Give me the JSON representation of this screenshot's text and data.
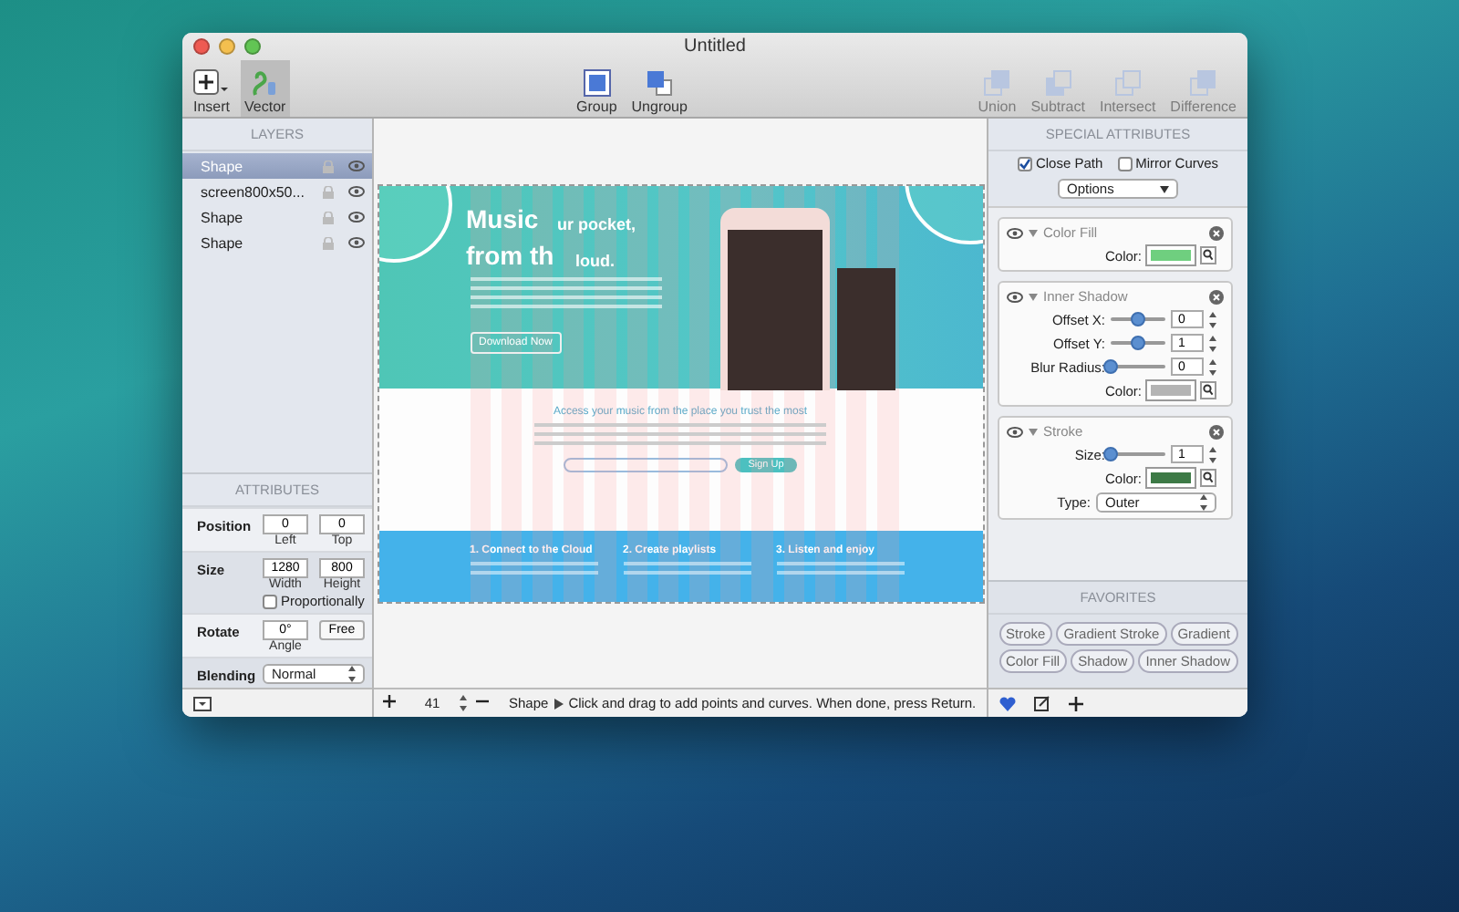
{
  "window": {
    "title": "Untitled"
  },
  "toolbar": {
    "left": [
      {
        "kind": "insert",
        "label": "Insert",
        "selected": false
      },
      {
        "kind": "vector",
        "label": "Vector",
        "selected": true
      }
    ],
    "center": [
      {
        "kind": "group",
        "label": "Group",
        "disabled": false
      },
      {
        "kind": "ungroup",
        "label": "Ungroup",
        "disabled": false
      }
    ],
    "right": [
      {
        "kind": "union",
        "label": "Union",
        "disabled": true
      },
      {
        "kind": "subtract",
        "label": "Subtract",
        "disabled": true
      },
      {
        "kind": "intersect",
        "label": "Intersect",
        "disabled": true
      },
      {
        "kind": "difference",
        "label": "Difference",
        "disabled": true
      }
    ]
  },
  "layers": {
    "title": "LAYERS",
    "items": [
      {
        "name": "Shape",
        "selected": true
      },
      {
        "name": "screen800x50...",
        "selected": false
      },
      {
        "name": "Shape",
        "selected": false
      },
      {
        "name": "Shape",
        "selected": false
      }
    ]
  },
  "attributes": {
    "title": "ATTRIBUTES",
    "rows": [
      {
        "kind": "fields",
        "label": "Position",
        "fields": [
          {
            "value": "0",
            "caption": "Left"
          },
          {
            "value": "0",
            "caption": "Top"
          }
        ]
      },
      {
        "kind": "fields",
        "label": "Size",
        "fields": [
          {
            "value": "1280",
            "caption": "Width"
          },
          {
            "value": "800",
            "caption": "Height"
          }
        ],
        "checkbox": {
          "label": "Proportionally",
          "checked": false
        }
      },
      {
        "kind": "fields",
        "label": "Rotate",
        "fields": [
          {
            "value": "0°",
            "caption": "Angle"
          }
        ],
        "button": "Free"
      },
      {
        "kind": "select",
        "label": "Blending",
        "value": "Normal"
      }
    ]
  },
  "canvas": {
    "document": {
      "hero_lines": [
        "Music",
        "ur pocket,",
        "from th",
        "loud."
      ],
      "download": "Download Now",
      "tagline": "Access your music from the place you trust the most",
      "signup": "Sign Up",
      "steps": [
        "1. Connect to the Cloud",
        "2. Create playlists",
        "3. Listen and enjoy"
      ]
    }
  },
  "status": {
    "zoom": "41",
    "tool": "Shape",
    "hint": "Click and drag to add points and curves. When done, press Return."
  },
  "special": {
    "title": "SPECIAL ATTRIBUTES",
    "close_path": {
      "label": "Close Path",
      "checked": true
    },
    "mirror_curves": {
      "label": "Mirror Curves",
      "checked": false
    },
    "options": "Options",
    "effects": [
      {
        "title": "Color Fill",
        "rows": [
          {
            "kind": "color",
            "label": "Color:",
            "color": "#6fcf7f"
          }
        ]
      },
      {
        "title": "Inner Shadow",
        "rows": [
          {
            "kind": "slider",
            "label": "Offset X:",
            "level": 0.5,
            "value": "0"
          },
          {
            "kind": "slider",
            "label": "Offset Y:",
            "level": 0.5,
            "value": "1"
          },
          {
            "kind": "slider",
            "label": "Blur Radius:",
            "level": 0,
            "value": "0"
          },
          {
            "kind": "color",
            "label": "Color:",
            "color": "#b4b4b4"
          }
        ]
      },
      {
        "title": "Stroke",
        "rows": [
          {
            "kind": "slider",
            "label": "Size:",
            "level": 0,
            "value": "1"
          },
          {
            "kind": "color",
            "label": "Color:",
            "color": "#3d7a46"
          },
          {
            "kind": "select",
            "label": "Type:",
            "value": "Outer"
          }
        ]
      }
    ]
  },
  "favorites": {
    "title": "FAVORITES",
    "items": [
      "Stroke",
      "Gradient Stroke",
      "Gradient",
      "Color Fill",
      "Shadow",
      "Inner Shadow"
    ]
  }
}
